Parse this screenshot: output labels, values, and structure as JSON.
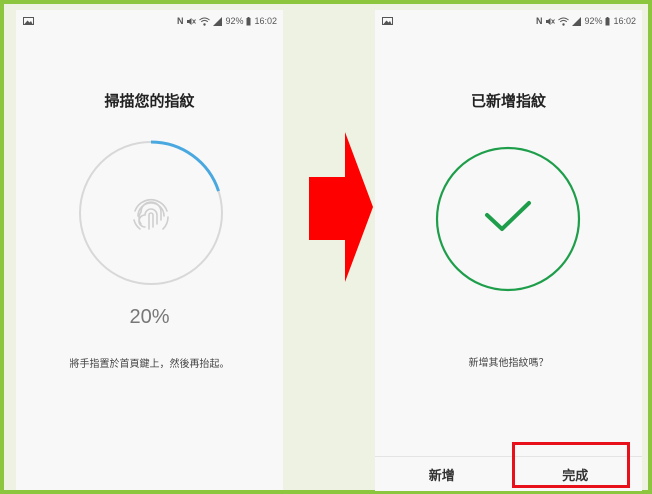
{
  "status_bar": {
    "battery": "92%",
    "time": "16:02"
  },
  "left_screen": {
    "title": "掃描您的指紋",
    "progress_percent": 20,
    "progress_text": "20%",
    "instruction": "將手指置於首頁鍵上，然後再抬起。"
  },
  "right_screen": {
    "title": "已新增指紋",
    "question": "新增其他指紋嗎？",
    "add_label": "新增",
    "done_label": "完成"
  },
  "colors": {
    "frame": "#8cc63f",
    "progress_arc": "#4aa8e0",
    "ring_track": "#d8d8d8",
    "success_green": "#1e9e4a",
    "arrow": "#ff0000",
    "highlight": "#e8101a"
  }
}
